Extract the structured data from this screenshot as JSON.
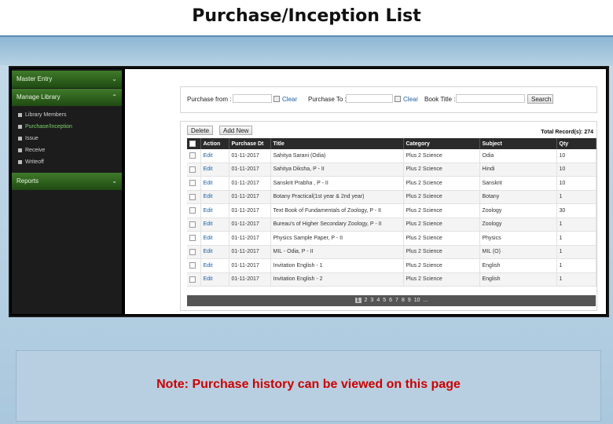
{
  "slide_title": "Purchase/Inception List",
  "note": "Note: Purchase history can be viewed on this page",
  "sidebar": {
    "master_entry": "Master Entry",
    "manage_library": "Manage Library",
    "sub_items": [
      "Library Members",
      "Purchase/Inception",
      "Issue",
      "Receive",
      "Writeoff"
    ],
    "reports": "Reports",
    "chevron_glyph": "⌄"
  },
  "search": {
    "purchase_from_label": "Purchase from :",
    "clear1": "Clear",
    "purchase_to_label": "Purchase To :",
    "clear2": "Clear",
    "book_title_label": "Book Title :",
    "search_btn": "Search"
  },
  "list": {
    "delete_btn": "Delete",
    "add_new_btn": "Add New",
    "total_records": "Total Record(s): 274",
    "columns": [
      "Action",
      "Purchase Dt",
      "Title",
      "Category",
      "Subject",
      "Qty"
    ],
    "rows": [
      {
        "action": "Edit",
        "date": "01-11-2017",
        "title": "Sahitya Sarani (Odia)",
        "category": "Plus 2 Science",
        "subject": "Odia",
        "qty": "10"
      },
      {
        "action": "Edit",
        "date": "01-11-2017",
        "title": "Sahitya Diksha, P - II",
        "category": "Plus 2 Science",
        "subject": "Hindi",
        "qty": "10"
      },
      {
        "action": "Edit",
        "date": "01-11-2017",
        "title": "Sanskrit Prabha , P - II",
        "category": "Plus 2 Science",
        "subject": "Sanskrit",
        "qty": "10"
      },
      {
        "action": "Edit",
        "date": "01-11-2017",
        "title": "Botany Practical(1st year & 2nd year)",
        "category": "Plus 2 Science",
        "subject": "Botany",
        "qty": "1"
      },
      {
        "action": "Edit",
        "date": "01-11-2017",
        "title": "Text Book of Fundamentals of Zoology, P - II",
        "category": "Plus 2 Science",
        "subject": "Zoology",
        "qty": "30"
      },
      {
        "action": "Edit",
        "date": "01-11-2017",
        "title": "Bureau's of Higher Secondary Zoology, P - II",
        "category": "Plus 2 Science",
        "subject": "Zoology",
        "qty": "1"
      },
      {
        "action": "Edit",
        "date": "01-11-2017",
        "title": "Physics Sample Paper, P - II",
        "category": "Plus 2 Science",
        "subject": "Physics",
        "qty": "1"
      },
      {
        "action": "Edit",
        "date": "01-11-2017",
        "title": "MIL - Odia, P - II",
        "category": "Plus 2 Science",
        "subject": "MIL (O)",
        "qty": "1"
      },
      {
        "action": "Edit",
        "date": "01-11-2017",
        "title": "Invitation English - 1",
        "category": "Plus 2 Science",
        "subject": "English",
        "qty": "1"
      },
      {
        "action": "Edit",
        "date": "01-11-2017",
        "title": "Invitation English - 2",
        "category": "Plus 2 Science",
        "subject": "English",
        "qty": "1"
      }
    ],
    "pages": [
      "1",
      "2",
      "3",
      "4",
      "5",
      "6",
      "7",
      "8",
      "9",
      "10",
      "..."
    ]
  }
}
